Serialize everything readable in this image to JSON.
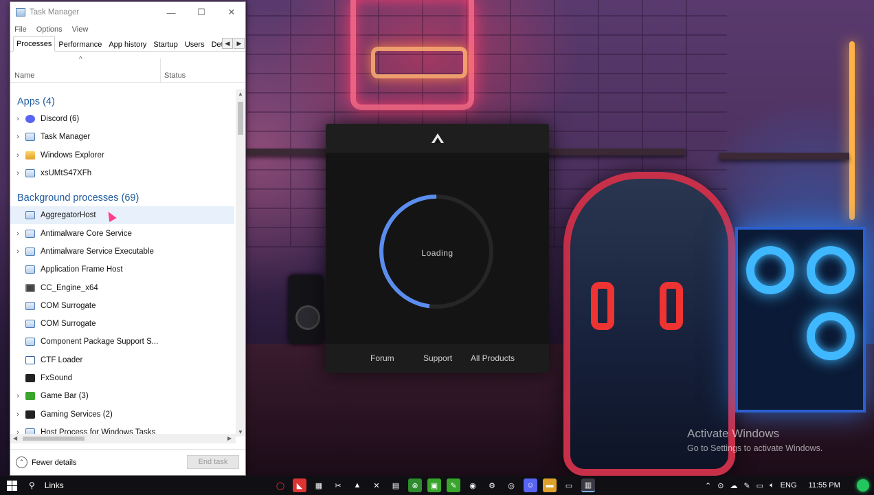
{
  "task_manager": {
    "title": "Task Manager",
    "window_buttons": {
      "minimize": "—",
      "maximize": "☐",
      "close": "✕"
    },
    "menu": [
      "File",
      "Options",
      "View"
    ],
    "tabs": [
      "Processes",
      "Performance",
      "App history",
      "Startup",
      "Users",
      "Det"
    ],
    "active_tab": "Processes",
    "columns": {
      "name": "Name",
      "status": "Status",
      "sort_indicator": "^"
    },
    "apps_header": "Apps (4)",
    "apps": [
      {
        "name": "Discord (6)",
        "icon": "discord-icon",
        "expandable": true
      },
      {
        "name": "Task Manager",
        "icon": "task-manager-icon",
        "expandable": true
      },
      {
        "name": "Windows Explorer",
        "icon": "folder-icon",
        "expandable": true
      },
      {
        "name": "xsUMtS47XFh",
        "icon": "app-window-icon",
        "expandable": true
      }
    ],
    "background_header": "Background processes (69)",
    "background": [
      {
        "name": "AggregatorHost",
        "icon": "app-window-icon",
        "expandable": false
      },
      {
        "name": "Antimalware Core Service",
        "icon": "app-window-icon",
        "expandable": true
      },
      {
        "name": "Antimalware Service Executable",
        "icon": "app-window-icon",
        "expandable": true
      },
      {
        "name": "Application Frame Host",
        "icon": "app-window-icon",
        "expandable": false
      },
      {
        "name": "CC_Engine_x64",
        "icon": "building-icon",
        "expandable": false
      },
      {
        "name": "COM Surrogate",
        "icon": "app-window-icon",
        "expandable": false
      },
      {
        "name": "COM Surrogate",
        "icon": "app-window-icon",
        "expandable": false
      },
      {
        "name": "Component Package Support S...",
        "icon": "app-window-icon",
        "expandable": false
      },
      {
        "name": "CTF Loader",
        "icon": "pen-icon",
        "expandable": false
      },
      {
        "name": "FxSound",
        "icon": "fxsound-icon",
        "expandable": false
      },
      {
        "name": "Game Bar (3)",
        "icon": "game-bar-icon",
        "expandable": true
      },
      {
        "name": "Gaming Services (2)",
        "icon": "gaming-services-icon",
        "expandable": true
      },
      {
        "name": "Host Process for Windows Tasks",
        "icon": "app-window-icon",
        "expandable": true
      }
    ],
    "footer": {
      "fewer_details": "Fewer details",
      "end_task": "End task"
    }
  },
  "launcher": {
    "status": "Loading",
    "progress": 0.48,
    "accent_color": "#5b8def",
    "links": [
      "Forum",
      "Support",
      "All Products"
    ]
  },
  "desktop": {
    "watermark_title": "Activate Windows",
    "watermark_sub": "Go to Settings to activate Windows."
  },
  "taskbar": {
    "search_label": "Links",
    "language": "ENG",
    "clock": "11:55 PM"
  }
}
